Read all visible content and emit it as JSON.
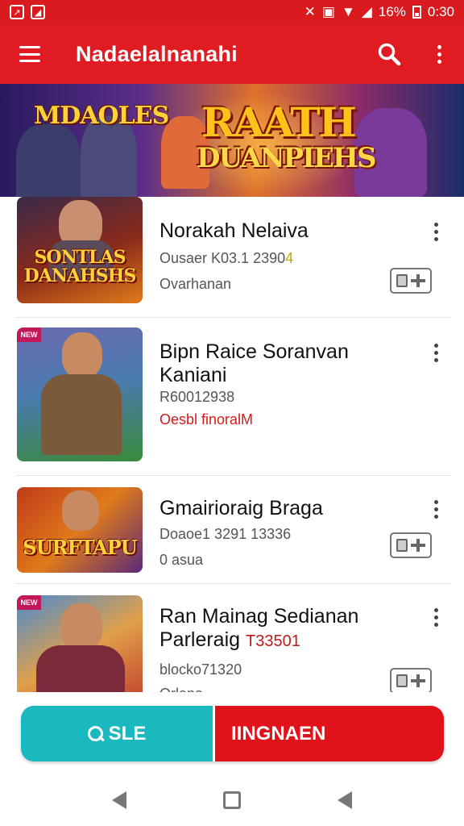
{
  "status_bar": {
    "battery": "16%",
    "time": "0:30"
  },
  "app_bar": {
    "title": "Nadaelalnanahi",
    "icons": [
      "menu-icon",
      "search-icon",
      "more-vert-icon"
    ]
  },
  "banner": {
    "logo_text": "MDAOLES",
    "title_line1": "RAATH",
    "title_line2": "DUANPIEHS"
  },
  "list": {
    "items": [
      {
        "thumb_text": "SONTLAS DANAHSHS",
        "title": "Norakah Nelaiva",
        "meta": "Ousaer K03.1 2390",
        "meta_highlight": "4",
        "sub": "Ovarhanan",
        "icons": [
          "more-vert-icon",
          "gamepad-icon"
        ]
      },
      {
        "thumb_badge": "NEW",
        "title": "Bipn Raice Soranvan Kaniani",
        "meta": "R60012938",
        "sub": "Oesbl finoralM",
        "icons": [
          "more-vert-icon"
        ]
      },
      {
        "thumb_text": "SURFTAPU",
        "title": "Gmairioraig Braga",
        "meta": "Doaoe1 3291 13336",
        "sub": "0 asua",
        "icons": [
          "more-vert-icon",
          "gamepad-icon"
        ]
      },
      {
        "thumb_badge": "NEW",
        "title": "Ran Mainag Sedianan Parleraig",
        "title_highlight": "T33501",
        "meta": "blocko71320",
        "sub": "Orlana",
        "icons": [
          "more-vert-icon",
          "gamepad-icon"
        ]
      }
    ]
  },
  "bottom_actions": {
    "search_label": "SLE",
    "primary_label": "IINGNAEN"
  },
  "colors": {
    "brand_red": "#e01b22",
    "teal": "#1ab8bf"
  }
}
